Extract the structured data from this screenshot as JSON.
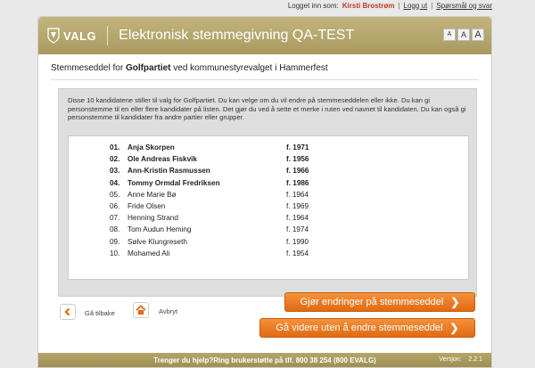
{
  "topbar": {
    "logged_in_label": "Logget inn som:",
    "user": "Kirsti Brostrøm",
    "logout": "Logg ut",
    "faq": "Spørsmål og svar"
  },
  "header": {
    "logo_text": "VALG",
    "title": "Elektronisk stemmegivning QA-TEST",
    "font_small": "A",
    "font_medium": "A",
    "font_large": "A"
  },
  "subtitle": {
    "prefix": "Stemmeseddel for",
    "party": "Golfpartiet",
    "suffix": "ved kommunestyrevalget i Hammerfest"
  },
  "intro": "Disse 10 kandidatene stiller til valg for Golfpartiet. Du kan velge om du vil endre på stemmeseddelen eller ikke. Du kan gi personstemme til en eller flere kandidater på listen. Det gjør du ved å sette et merke i ruten ved navnet til kandidaten. Du kan også gi personstemme til kandidater fra andre partier eller grupper.",
  "candidates": [
    {
      "num": "01.",
      "name": "Anja Skorpen",
      "year": "f. 1971"
    },
    {
      "num": "02.",
      "name": "Ole Andreas Fiskvik",
      "year": "f. 1956"
    },
    {
      "num": "03.",
      "name": "Ann-Kristin Rasmussen",
      "year": "f. 1966"
    },
    {
      "num": "04.",
      "name": "Tommy Ormdal Fredriksen",
      "year": "f. 1986"
    },
    {
      "num": "05.",
      "name": "Anne Marie Bø",
      "year": "f. 1964"
    },
    {
      "num": "06.",
      "name": "Fride Olsen",
      "year": "f. 1969"
    },
    {
      "num": "07.",
      "name": "Henning Strand",
      "year": "f. 1964"
    },
    {
      "num": "08.",
      "name": "Tom Audun Heming",
      "year": "f. 1974"
    },
    {
      "num": "09.",
      "name": "Sølve Klungreseth",
      "year": "f. 1990"
    },
    {
      "num": "10.",
      "name": "Mohamed Ali",
      "year": "f. 1954"
    }
  ],
  "actions": {
    "back": "Gå tilbake",
    "cancel": "Avbryt",
    "change": "Gjør endringer på stemmeseddel",
    "continue": "Gå videre uten å endre stemmeseddel"
  },
  "footer": {
    "help": "Trenger du hjelp?Ring brukerstøtte på tlf. 800 38 254 (800 EVALG)",
    "version_label": "Versjon:",
    "version": "2.2.1"
  },
  "colors": {
    "header": "#b5a76d",
    "accent_orange": "#ed7d22",
    "user_red": "#c0392b"
  }
}
